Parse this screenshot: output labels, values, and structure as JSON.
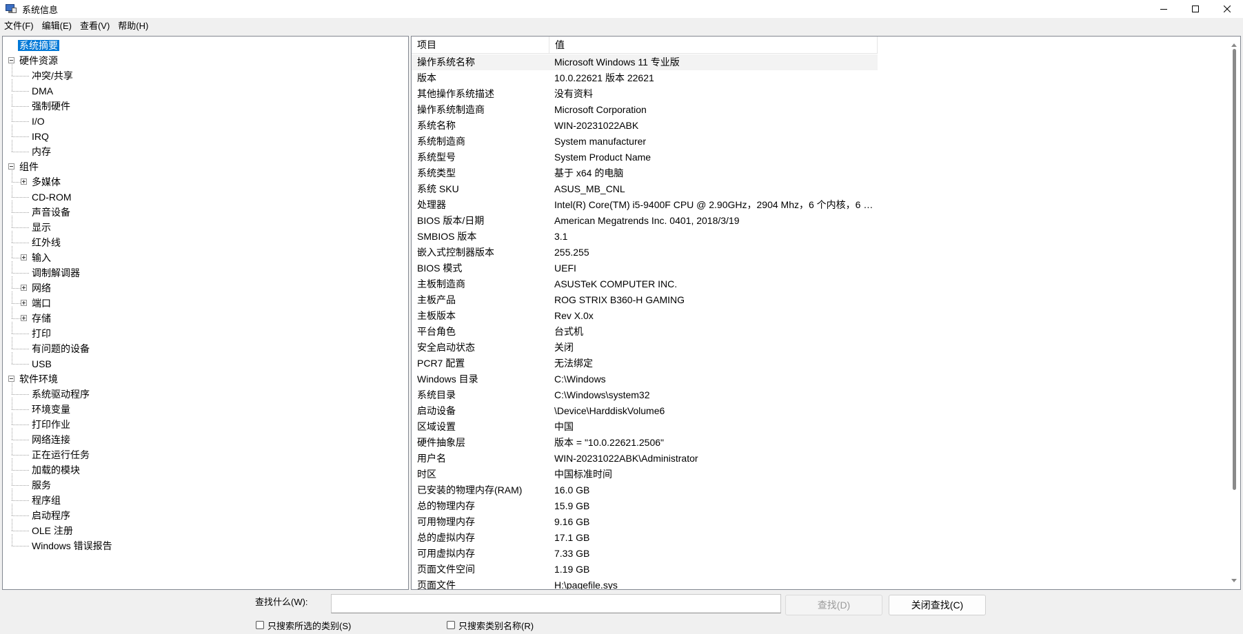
{
  "window": {
    "title": "系统信息",
    "icon": "system-info-icon"
  },
  "menu": {
    "items": [
      "文件(F)",
      "编辑(E)",
      "查看(V)",
      "帮助(H)"
    ]
  },
  "tree": {
    "items": [
      {
        "label": "系统摘要",
        "level": 0,
        "selected": true
      },
      {
        "label": "硬件资源",
        "level": 0,
        "expander": "minus"
      },
      {
        "label": "冲突/共享",
        "level": 1
      },
      {
        "label": "DMA",
        "level": 1
      },
      {
        "label": "强制硬件",
        "level": 1
      },
      {
        "label": "I/O",
        "level": 1
      },
      {
        "label": "IRQ",
        "level": 1
      },
      {
        "label": "内存",
        "level": 1
      },
      {
        "label": "组件",
        "level": 0,
        "expander": "minus"
      },
      {
        "label": "多媒体",
        "level": 1,
        "expander": "plus"
      },
      {
        "label": "CD-ROM",
        "level": 1
      },
      {
        "label": "声音设备",
        "level": 1
      },
      {
        "label": "显示",
        "level": 1
      },
      {
        "label": "红外线",
        "level": 1
      },
      {
        "label": "输入",
        "level": 1,
        "expander": "plus"
      },
      {
        "label": "调制解调器",
        "level": 1
      },
      {
        "label": "网络",
        "level": 1,
        "expander": "plus"
      },
      {
        "label": "端口",
        "level": 1,
        "expander": "plus"
      },
      {
        "label": "存储",
        "level": 1,
        "expander": "plus"
      },
      {
        "label": "打印",
        "level": 1
      },
      {
        "label": "有问题的设备",
        "level": 1
      },
      {
        "label": "USB",
        "level": 1
      },
      {
        "label": "软件环境",
        "level": 0,
        "expander": "minus"
      },
      {
        "label": "系统驱动程序",
        "level": 1
      },
      {
        "label": "环境变量",
        "level": 1
      },
      {
        "label": "打印作业",
        "level": 1
      },
      {
        "label": "网络连接",
        "level": 1
      },
      {
        "label": "正在运行任务",
        "level": 1
      },
      {
        "label": "加载的模块",
        "level": 1
      },
      {
        "label": "服务",
        "level": 1
      },
      {
        "label": "程序组",
        "level": 1
      },
      {
        "label": "启动程序",
        "level": 1
      },
      {
        "label": "OLE 注册",
        "level": 1
      },
      {
        "label": "Windows 错误报告",
        "level": 1
      }
    ]
  },
  "list": {
    "columns": [
      "项目",
      "值"
    ],
    "rows": [
      [
        "操作系统名称",
        "Microsoft Windows 11 专业版"
      ],
      [
        "版本",
        "10.0.22621 版本 22621"
      ],
      [
        "其他操作系统描述",
        "没有资料"
      ],
      [
        "操作系统制造商",
        "Microsoft Corporation"
      ],
      [
        "系统名称",
        "WIN-20231022ABK"
      ],
      [
        "系统制造商",
        "System manufacturer"
      ],
      [
        "系统型号",
        "System Product Name"
      ],
      [
        "系统类型",
        "基于 x64 的电脑"
      ],
      [
        "系统 SKU",
        "ASUS_MB_CNL"
      ],
      [
        "处理器",
        "Intel(R) Core(TM) i5-9400F CPU @ 2.90GHz，2904 Mhz，6 个内核，6 个..."
      ],
      [
        "BIOS 版本/日期",
        "American Megatrends Inc. 0401, 2018/3/19"
      ],
      [
        "SMBIOS 版本",
        "3.1"
      ],
      [
        "嵌入式控制器版本",
        "255.255"
      ],
      [
        "BIOS 模式",
        "UEFI"
      ],
      [
        "主板制造商",
        "ASUSTeK COMPUTER INC."
      ],
      [
        "主板产品",
        "ROG STRIX B360-H GAMING"
      ],
      [
        "主板版本",
        "Rev X.0x"
      ],
      [
        "平台角色",
        "台式机"
      ],
      [
        "安全启动状态",
        "关闭"
      ],
      [
        "PCR7 配置",
        "无法绑定"
      ],
      [
        "Windows 目录",
        "C:\\Windows"
      ],
      [
        "系统目录",
        "C:\\Windows\\system32"
      ],
      [
        "启动设备",
        "\\Device\\HarddiskVolume6"
      ],
      [
        "区域设置",
        "中国"
      ],
      [
        "硬件抽象层",
        "版本 = \"10.0.22621.2506\""
      ],
      [
        "用户名",
        "WIN-20231022ABK\\Administrator"
      ],
      [
        "时区",
        "中国标准时间"
      ],
      [
        "已安装的物理内存(RAM)",
        "16.0 GB"
      ],
      [
        "总的物理内存",
        "15.9 GB"
      ],
      [
        "可用物理内存",
        "9.16 GB"
      ],
      [
        "总的虚拟内存",
        "17.1 GB"
      ],
      [
        "可用虚拟内存",
        "7.33 GB"
      ],
      [
        "页面文件空间",
        "1.19 GB"
      ],
      [
        "页面文件",
        "H:\\pagefile.sys"
      ]
    ]
  },
  "find": {
    "label": "查找什么(W):",
    "value": "",
    "find_button": "查找(D)",
    "close_button": "关闭查找(C)",
    "option_selected_category": "只搜索所选的类别(S)",
    "option_category_names": "只搜索类别名称(R)"
  }
}
